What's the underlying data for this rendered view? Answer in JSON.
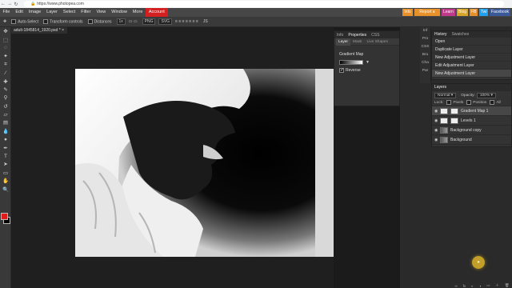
{
  "browser": {
    "url": "https://www.photopea.com"
  },
  "menu": {
    "items": [
      "File",
      "Edit",
      "Image",
      "Layer",
      "Select",
      "Filter",
      "View",
      "Window",
      "More"
    ],
    "account": "Account"
  },
  "top_buttons": [
    {
      "label": "Info",
      "color": "#e8902a"
    },
    {
      "label": "Report a bug",
      "color": "#e8902a"
    },
    {
      "label": "Learn",
      "color": "#c0398a"
    },
    {
      "label": "Blog",
      "color": "#d8a52b"
    },
    {
      "label": "FB",
      "color": "#e8902a"
    },
    {
      "label": "Twi",
      "color": "#1da1f2"
    },
    {
      "label": "Facebook",
      "color": "#3b5998"
    }
  ],
  "options_bar": {
    "auto_select": "Auto-Select",
    "transform_controls": "Transform controls",
    "distances": "Distances",
    "zoom_drop": "1x",
    "png_label": "PNG",
    "svg_label": "SVG",
    "js_label": "JS"
  },
  "document": {
    "tab_title": "adult-1845814_1920.psd *"
  },
  "properties": {
    "tabs": [
      "Info",
      "Properties",
      "CSS"
    ],
    "subtabs": [
      "Layer",
      "Mask",
      "Live Shapes"
    ],
    "section_label": "Gradient Map",
    "reverse_label": "Reverse"
  },
  "mini_tabs": [
    "Inf",
    "Pro",
    "CSS",
    "Bru",
    "Cha",
    "Par"
  ],
  "history": {
    "tabs": [
      "History",
      "Swatches"
    ],
    "items": [
      "Open",
      "Duplicate Layer",
      "New Adjustment Layer",
      "Edit Adjustment Layer",
      "New Adjustment Layer"
    ]
  },
  "layers": {
    "header": "Layers",
    "blend_mode": "Normal",
    "opacity_label": "Opacity:",
    "opacity_value": "100%",
    "lock_label": "Lock:",
    "lock_options": [
      "Pixels",
      "Position",
      "All"
    ],
    "rows": [
      {
        "name": "Gradient Map 1",
        "kind": "adjustment"
      },
      {
        "name": "Levels 1",
        "kind": "adjustment"
      },
      {
        "name": "Background copy",
        "kind": "photo"
      },
      {
        "name": "Background",
        "kind": "photo"
      }
    ]
  },
  "colors": {
    "menu_bg": "#474747",
    "panel_bg": "#333333",
    "account_red": "#d32020",
    "foreground_color": "#e01b1b",
    "background_color": "#000000"
  }
}
